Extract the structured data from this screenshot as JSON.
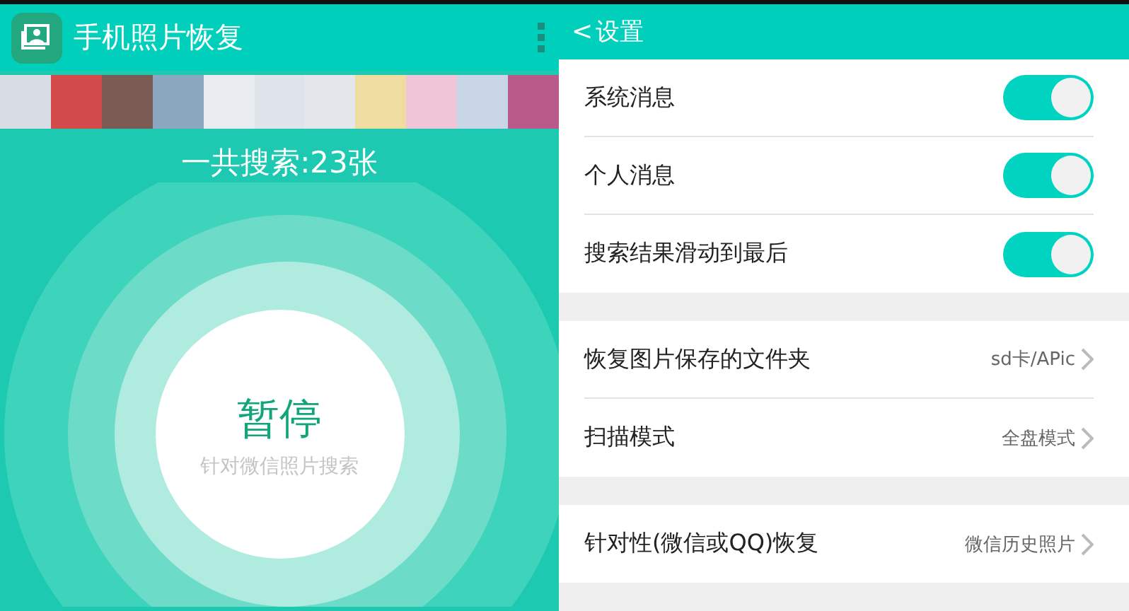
{
  "recovery_screen": {
    "app_title": "手机照片恢复",
    "found_count": "一共搜索:23张",
    "pause_button": {
      "label": "暂停",
      "subtitle": "针对微信照片搜索"
    }
  },
  "settings_screen": {
    "back": "<",
    "title": "设置",
    "sections": [
      [
        {
          "kind": "toggle",
          "label": "系统消息",
          "on": true
        },
        {
          "kind": "toggle",
          "label": "个人消息",
          "on": true
        },
        {
          "kind": "toggle",
          "label": "搜索结果滑动到最后",
          "on": true
        }
      ],
      [
        {
          "kind": "link",
          "label": "恢复图片保存的文件夹",
          "value": "sd卡/APic"
        },
        {
          "kind": "link",
          "label": "扫描模式",
          "value": "全盘模式"
        }
      ],
      [
        {
          "kind": "link",
          "label": "针对性(微信或QQ)恢复",
          "value": "微信历史照片"
        }
      ]
    ]
  }
}
